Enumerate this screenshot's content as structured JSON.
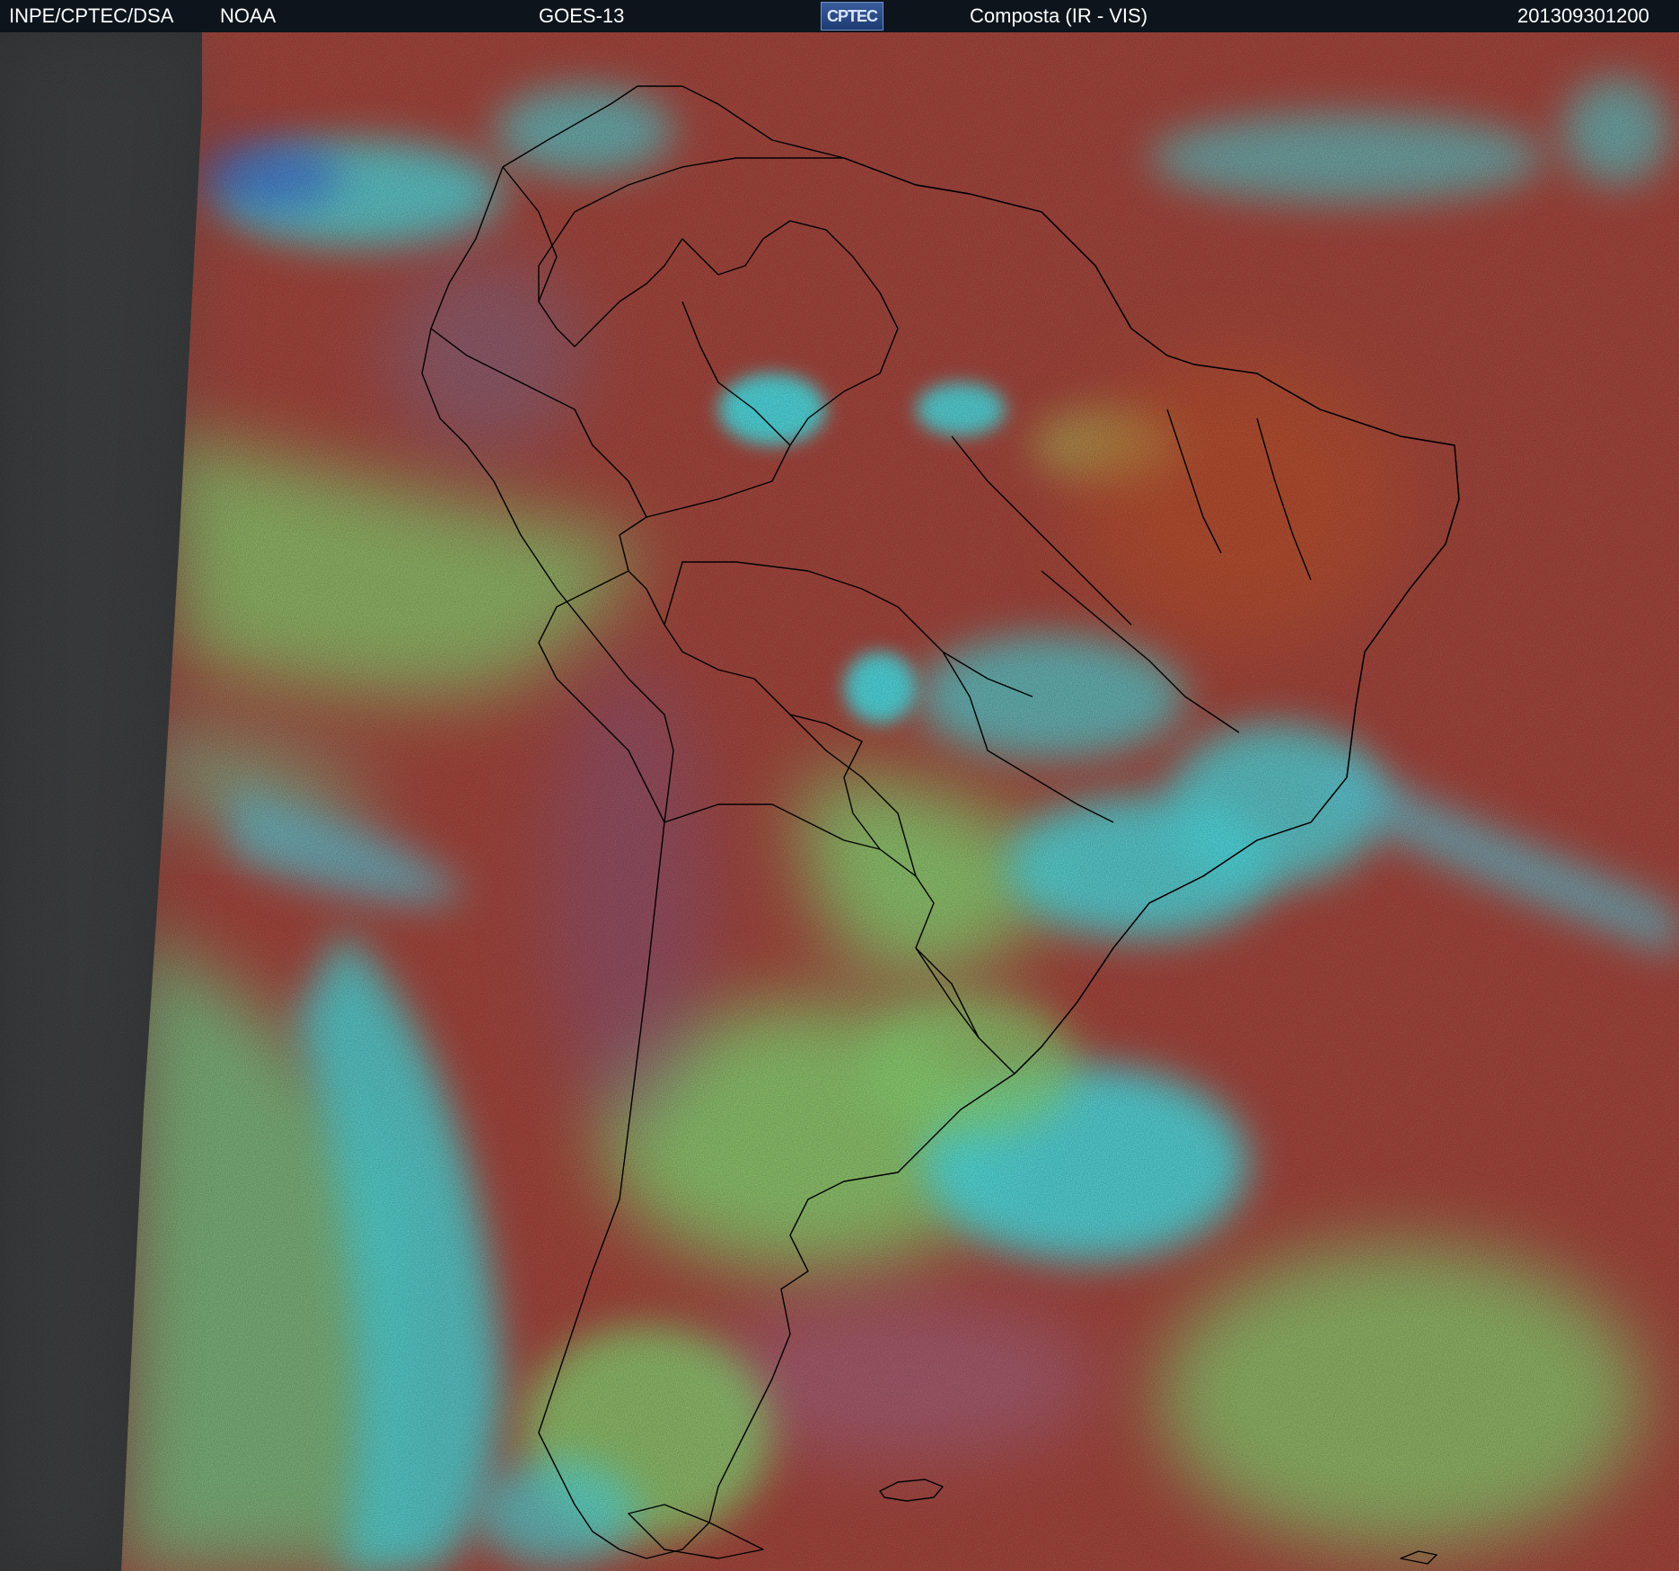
{
  "header": {
    "agency": "INPE/CPTEC/DSA",
    "partner": "NOAA",
    "satellite": "GOES-13",
    "logo_text": "CPTEC",
    "product": "Composta (IR - VIS)",
    "timestamp": "201309301200"
  },
  "map": {
    "region": "South America",
    "colors": {
      "background": "#0d141c",
      "land_clear": "#b0483a",
      "ocean_clear": "#ad4a40",
      "low_cloud": "#8fe37a",
      "high_cloud": "#4feaf0",
      "mid_cloud": "#7f7aa8",
      "no_vis_area": "#3a3b3d",
      "borders": "#000000"
    }
  }
}
